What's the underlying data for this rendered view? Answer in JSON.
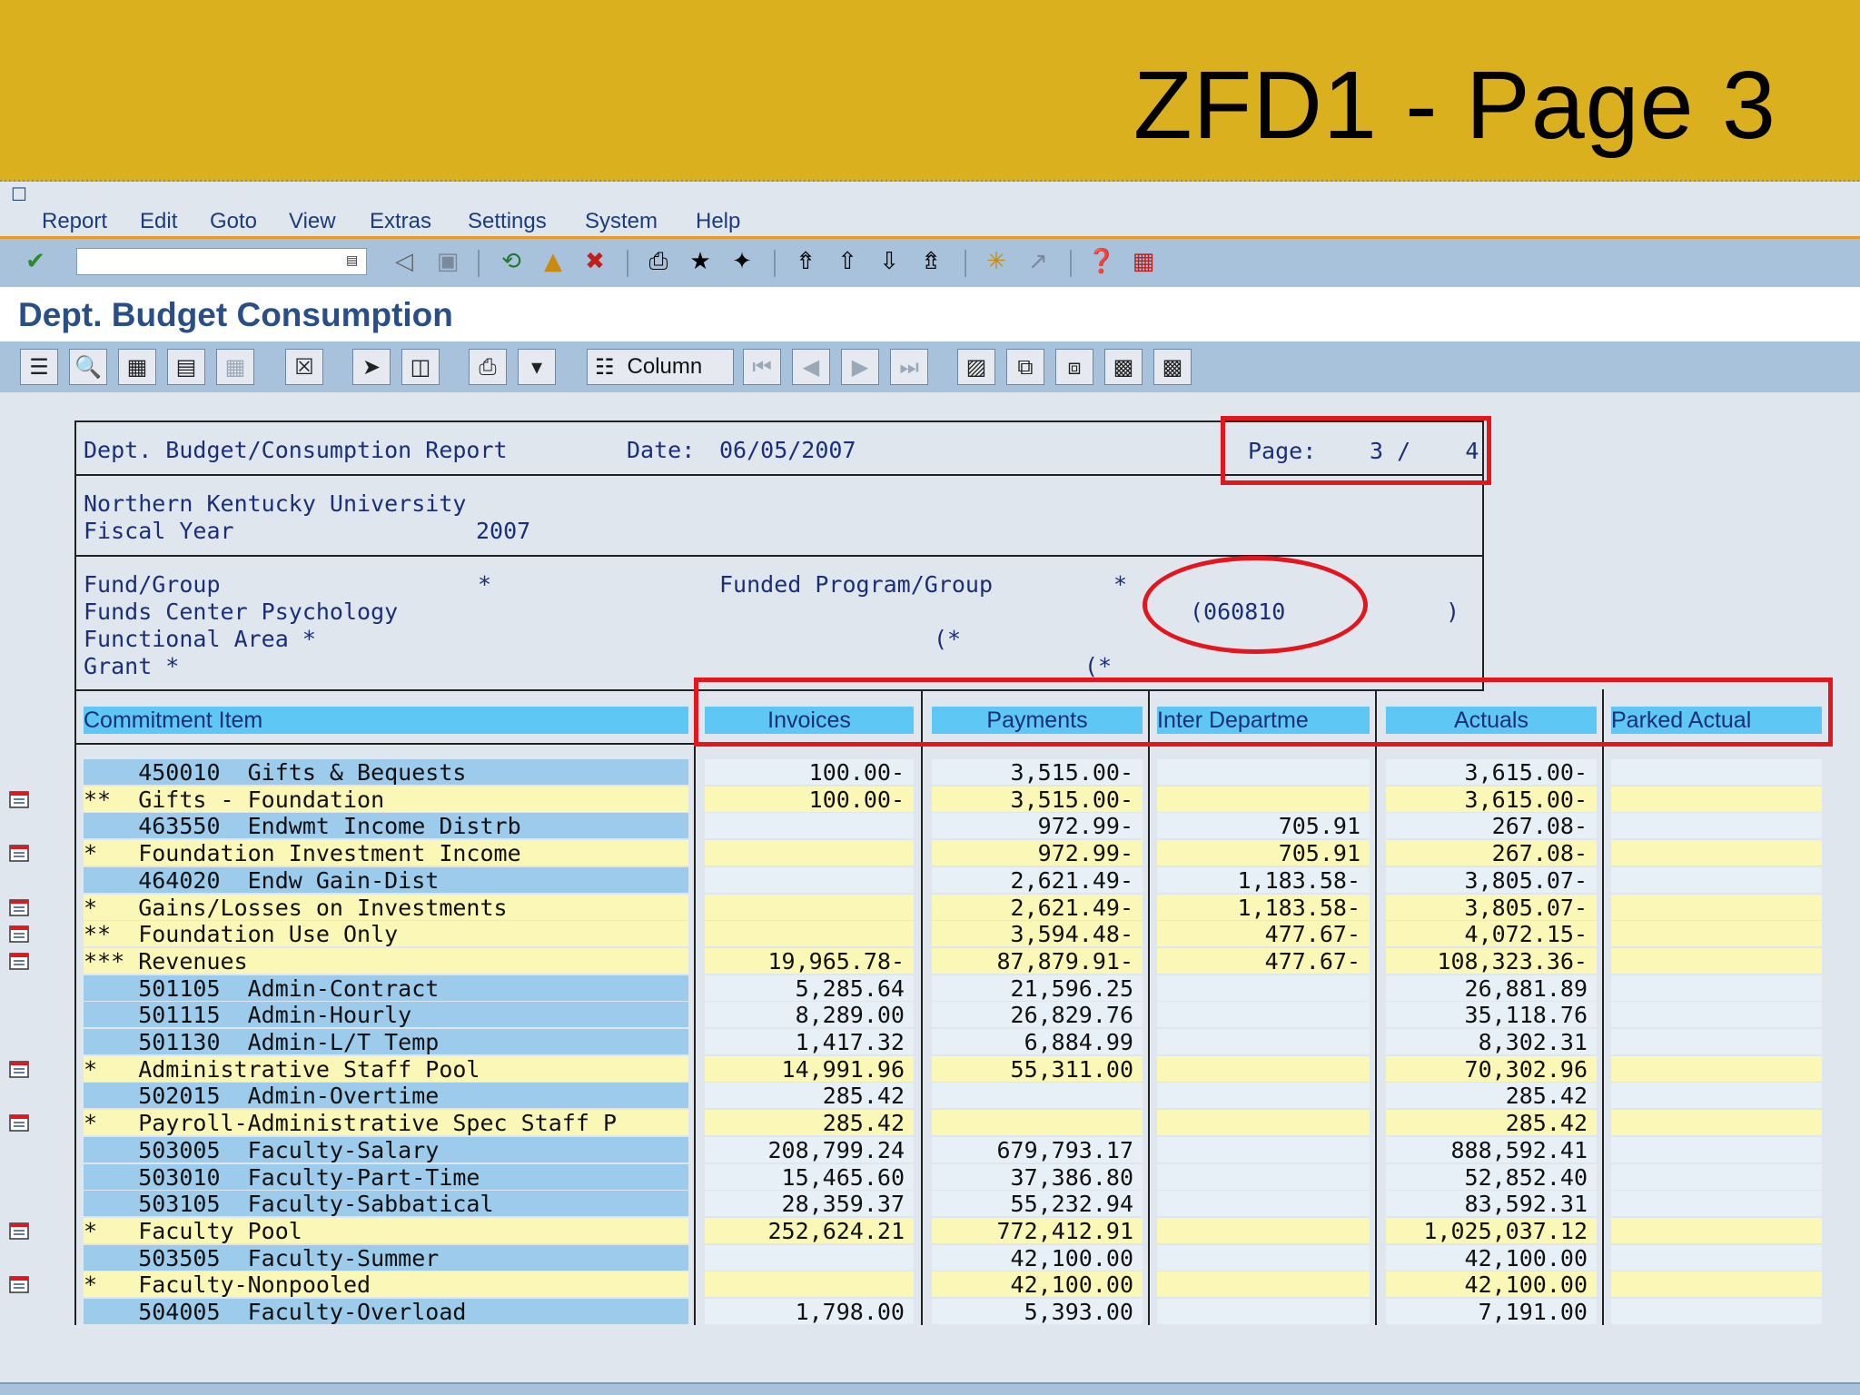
{
  "slide": {
    "title": "ZFD1 - Page 3"
  },
  "menu": [
    "Report",
    "Edit",
    "Goto",
    "View",
    "Extras",
    "Settings",
    "System",
    "Help"
  ],
  "screen_title": "Dept. Budget Consumption",
  "toolbar2": {
    "column_label": "Column"
  },
  "header": {
    "report_title": "Dept. Budget/Consumption Report",
    "date_label": "Date:",
    "date_value": "06/05/2007",
    "page_label": "Page:",
    "page_value": "3 /    4",
    "university": "Northern Kentucky University",
    "fiscal_year_label": "Fiscal Year",
    "fiscal_year": "2007",
    "fund_group_label": "Fund/Group",
    "fund_group_value": "*",
    "funded_program_label": "Funded Program/Group",
    "funded_program_value": "*",
    "funds_center": "Funds Center Psychology",
    "funds_center_code": "(060810",
    "funds_center_close": ")",
    "functional_area": "Functional Area *",
    "functional_area_paren": "(*",
    "grant": "Grant *",
    "grant_paren": "(*"
  },
  "columns": {
    "item": "Commitment Item",
    "invoices": "Invoices",
    "payments": "Payments",
    "inter": "Inter Departme",
    "actuals": "Actuals",
    "parked": "Parked Actual"
  },
  "rows": [
    {
      "type": "detail",
      "label": "    450010  Gifts & Bequests",
      "invoices": "100.00-",
      "payments": "3,515.00-",
      "inter": "",
      "actuals": "3,615.00-",
      "parked": "",
      "icon": false
    },
    {
      "type": "total",
      "label": "**  Gifts - Foundation",
      "invoices": "100.00-",
      "payments": "3,515.00-",
      "inter": "",
      "actuals": "3,615.00-",
      "parked": "",
      "icon": true
    },
    {
      "type": "detail",
      "label": "    463550  Endwmt Income Distrb",
      "invoices": "",
      "payments": "972.99-",
      "inter": "705.91",
      "actuals": "267.08-",
      "parked": "",
      "icon": false
    },
    {
      "type": "total",
      "label": "*   Foundation Investment Income",
      "invoices": "",
      "payments": "972.99-",
      "inter": "705.91",
      "actuals": "267.08-",
      "parked": "",
      "icon": true
    },
    {
      "type": "detail",
      "label": "    464020  Endw Gain-Dist",
      "invoices": "",
      "payments": "2,621.49-",
      "inter": "1,183.58-",
      "actuals": "3,805.07-",
      "parked": "",
      "icon": false
    },
    {
      "type": "total",
      "label": "*   Gains/Losses on Investments",
      "invoices": "",
      "payments": "2,621.49-",
      "inter": "1,183.58-",
      "actuals": "3,805.07-",
      "parked": "",
      "icon": true
    },
    {
      "type": "total",
      "label": "**  Foundation Use Only",
      "invoices": "",
      "payments": "3,594.48-",
      "inter": "477.67-",
      "actuals": "4,072.15-",
      "parked": "",
      "icon": true
    },
    {
      "type": "total",
      "label": "*** Revenues",
      "invoices": "19,965.78-",
      "payments": "87,879.91-",
      "inter": "477.67-",
      "actuals": "108,323.36-",
      "parked": "",
      "icon": true
    },
    {
      "type": "detail",
      "label": "    501105  Admin-Contract",
      "invoices": "5,285.64",
      "payments": "21,596.25",
      "inter": "",
      "actuals": "26,881.89",
      "parked": "",
      "icon": false
    },
    {
      "type": "detail",
      "label": "    501115  Admin-Hourly",
      "invoices": "8,289.00",
      "payments": "26,829.76",
      "inter": "",
      "actuals": "35,118.76",
      "parked": "",
      "icon": false
    },
    {
      "type": "detail",
      "label": "    501130  Admin-L/T Temp",
      "invoices": "1,417.32",
      "payments": "6,884.99",
      "inter": "",
      "actuals": "8,302.31",
      "parked": "",
      "icon": false
    },
    {
      "type": "total",
      "label": "*   Administrative Staff Pool",
      "invoices": "14,991.96",
      "payments": "55,311.00",
      "inter": "",
      "actuals": "70,302.96",
      "parked": "",
      "icon": true
    },
    {
      "type": "detail",
      "label": "    502015  Admin-Overtime",
      "invoices": "285.42",
      "payments": "",
      "inter": "",
      "actuals": "285.42",
      "parked": "",
      "icon": false
    },
    {
      "type": "total",
      "label": "*   Payroll-Administrative Spec Staff P",
      "invoices": "285.42",
      "payments": "",
      "inter": "",
      "actuals": "285.42",
      "parked": "",
      "icon": true
    },
    {
      "type": "detail",
      "label": "    503005  Faculty-Salary",
      "invoices": "208,799.24",
      "payments": "679,793.17",
      "inter": "",
      "actuals": "888,592.41",
      "parked": "",
      "icon": false
    },
    {
      "type": "detail",
      "label": "    503010  Faculty-Part-Time",
      "invoices": "15,465.60",
      "payments": "37,386.80",
      "inter": "",
      "actuals": "52,852.40",
      "parked": "",
      "icon": false
    },
    {
      "type": "detail",
      "label": "    503105  Faculty-Sabbatical",
      "invoices": "28,359.37",
      "payments": "55,232.94",
      "inter": "",
      "actuals": "83,592.31",
      "parked": "",
      "icon": false
    },
    {
      "type": "total",
      "label": "*   Faculty Pool",
      "invoices": "252,624.21",
      "payments": "772,412.91",
      "inter": "",
      "actuals": "1,025,037.12",
      "parked": "",
      "icon": true
    },
    {
      "type": "detail",
      "label": "    503505  Faculty-Summer",
      "invoices": "",
      "payments": "42,100.00",
      "inter": "",
      "actuals": "42,100.00",
      "parked": "",
      "icon": false
    },
    {
      "type": "total",
      "label": "*   Faculty-Nonpooled",
      "invoices": "",
      "payments": "42,100.00",
      "inter": "",
      "actuals": "42,100.00",
      "parked": "",
      "icon": true
    },
    {
      "type": "detail",
      "label": "    504005  Faculty-Overload",
      "invoices": "1,798.00",
      "payments": "5,393.00",
      "inter": "",
      "actuals": "7,191.00",
      "parked": "",
      "icon": false
    }
  ],
  "colors": {
    "banner": "#dbb01e",
    "detail_label": "#9ccbeb",
    "total_row": "#fbf7b7",
    "header_cell": "#5ec7f3",
    "highlight": "#e3161d"
  }
}
